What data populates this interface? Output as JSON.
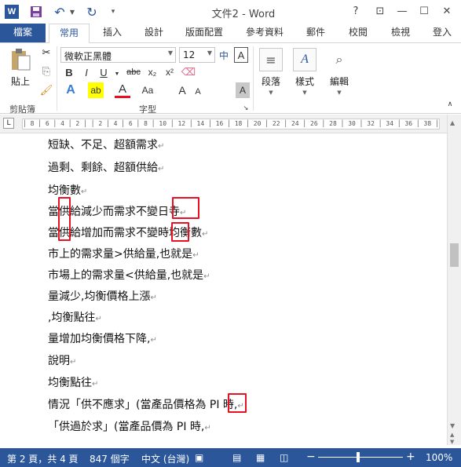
{
  "titlebar": {
    "title": "文件2 - Word",
    "help": "?",
    "restore_ribbon": "⊡",
    "minimize": "—",
    "maximize": "☐",
    "close": "✕"
  },
  "tabs": [
    {
      "label": "檔案"
    },
    {
      "label": "常用"
    },
    {
      "label": "插入"
    },
    {
      "label": "設計"
    },
    {
      "label": "版面配置"
    },
    {
      "label": "參考資料"
    },
    {
      "label": "郵件"
    },
    {
      "label": "校閱"
    },
    {
      "label": "檢視"
    },
    {
      "label": "登入"
    }
  ],
  "ribbon": {
    "clipboard": {
      "paste": "貼上",
      "group": "剪貼簿"
    },
    "font": {
      "name": "微軟正黑體",
      "size": "12",
      "phonetic": "中",
      "char_border": "A",
      "bold": "B",
      "italic": "I",
      "underline": "U",
      "strike": "abc",
      "subscript": "x₂",
      "superscript": "x²",
      "effects": "A",
      "font_color": "A",
      "grow": "A",
      "shrink": "A",
      "case": "Aa",
      "shade": "A",
      "group": "字型"
    },
    "paragraph": {
      "label": "段落"
    },
    "styles": {
      "label": "樣式"
    },
    "editing": {
      "label": "編輯"
    }
  },
  "ruler": {
    "corner": "L",
    "ticks": "│ 8 │ 6 │ 4 │ 2 │   │ 2 │ 4 │ 6 │ 8 │ 10 │ 12 │ 14 │ 16 │ 18 │ 20 │ 22 │ 24 │ 26 │ 28 │ 30 │ 32 │ 34 │ 36 │ 38 │ 40 │ 42 │ 44 │ 46 │ 48 │"
  },
  "document": {
    "lines": [
      {
        "text": "短缺、不足、超額需求"
      },
      {
        "text": "過剩、剩餘、超額供給"
      },
      {
        "text": "均衡數"
      },
      {
        "text": "當供給減少而需求不變日寺"
      },
      {
        "text": "當供給增加而需求不變時均衡數"
      },
      {
        "text": "市上的需求量>供給量,也就是"
      },
      {
        "text": "市場上的需求量<供給量,也就是"
      },
      {
        "text": "量減少,均衡價格上漲"
      },
      {
        "text": ",均衡點往"
      },
      {
        "text": "量增加均衡價格下降,"
      },
      {
        "text": "說明"
      },
      {
        "text": "均衡點往"
      },
      {
        "text": "情況「供不應求」(當產品價格為 PI 時,"
      },
      {
        "text": "「供過於求」(當產品價為 PI 時,"
      }
    ],
    "para_mark": "↵"
  },
  "status": {
    "page": "第 2 頁，共 4 頁",
    "words": "847 個字",
    "language": "中文 (台灣)",
    "zoom_minus": "−",
    "zoom_plus": "+",
    "zoom": "100%",
    "zoom_fraction": 0.5
  },
  "colors": {
    "accent": "#2b579a",
    "highlight": "#e81123"
  }
}
